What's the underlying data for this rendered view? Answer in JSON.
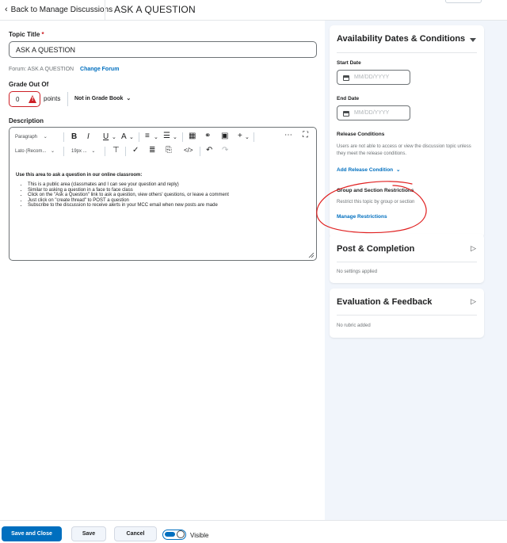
{
  "header": {
    "back_label": "Back to Manage Discussions",
    "page_title": "ASK A QUESTION"
  },
  "form": {
    "topic_title_label": "Topic Title",
    "required_mark": "*",
    "topic_title_value": "ASK A QUESTION",
    "forum_text": "Forum: ASK A QUESTION",
    "change_forum_link": "Change Forum",
    "grade_out_of_label": "Grade Out Of",
    "grade_value": "0",
    "points_label": "points",
    "gradebook_label": "Not in Grade Book",
    "description_label": "Description"
  },
  "editor": {
    "toolbar_row1": {
      "paragraph": "Paragraph",
      "bold": "B",
      "italic": "I",
      "underline": "U"
    },
    "toolbar_row2": {
      "font": "Lato (Recom...",
      "size": "19px ..."
    },
    "content": {
      "lead": "Use this area to ask a question in our online classroom:",
      "bullets": [
        "This is a public area (classmates and I can see your question and reply)",
        "Similar to asking a question in a face to face class",
        "Click on the \"Ask a Question\" link to ask a question, view others' questions, or leave a comment",
        "Just click on \"create thread\" to POST a question",
        "Subscribe to the discussion to receive alerts in your MCC email when new posts are made"
      ]
    }
  },
  "sidebar": {
    "availability": {
      "title": "Availability Dates & Conditions",
      "start_date_label": "Start Date",
      "start_date_placeholder": "MM/DD/YYYY",
      "end_date_label": "End Date",
      "end_date_placeholder": "MM/DD/YYYY",
      "release_conditions_label": "Release Conditions",
      "release_conditions_text": "Users are not able to access or view the discussion topic unless they meet the release conditions.",
      "add_release_condition": "Add Release Condition",
      "group_section_label": "Group and Section Restrictions",
      "group_section_text": "Restrict this topic by group or section",
      "manage_restrictions": "Manage Restrictions"
    },
    "post_completion": {
      "title": "Post & Completion",
      "status": "No settings applied"
    },
    "evaluation": {
      "title": "Evaluation & Feedback",
      "status": "No rubric added"
    }
  },
  "footer": {
    "save_close": "Save and Close",
    "save": "Save",
    "cancel": "Cancel",
    "visible_label": "Visible"
  },
  "colors": {
    "accent": "#006fbf",
    "error": "#cd2026",
    "annotation": "#e02020",
    "panel_bg": "#f1f5fb"
  }
}
